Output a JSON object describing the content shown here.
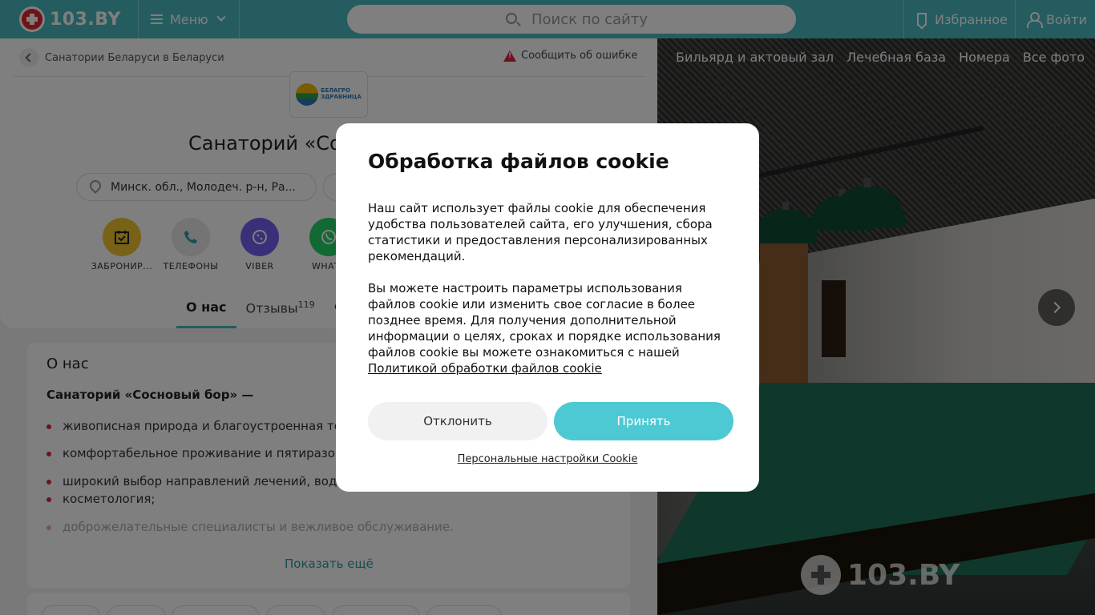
{
  "header": {
    "logo_text": "103.BY",
    "menu_label": "Меню",
    "search_placeholder": "Поиск по сайту",
    "favorites_label": "Избранное",
    "login_label": "Войти"
  },
  "breadcrumb": {
    "text": "Санатории Беларуси в Беларуси",
    "report_label": "Сообщить об ошибке"
  },
  "org": {
    "logo_text_top": "БЕЛАГРО",
    "logo_text_bottom": "ЗДРАВНИЦА",
    "title": "Санаторий «Со",
    "address": "Минск. обл., Молодеч. р-н, Ра..."
  },
  "actions": [
    {
      "label": "ЗАБРОНИР...",
      "icon": "calendar-check-icon",
      "color": "#f0c430"
    },
    {
      "label": "ТЕЛЕФОНЫ",
      "icon": "phone-icon",
      "color": "#e8e8e8"
    },
    {
      "label": "VIBER",
      "icon": "viber-icon",
      "color": "#7360f2"
    },
    {
      "label": "WHATS",
      "icon": "whatsapp-icon",
      "color": "#25d366"
    }
  ],
  "tabs": {
    "about": "О нас",
    "reviews": "Отзывы",
    "reviews_count": "119",
    "third": "Ф"
  },
  "about": {
    "heading": "О нас",
    "lead": "Санаторий «Сосновый бор» —",
    "bullets": [
      "живописная природа и благоустроенная те",
      "комфортабельное проживание и пятиразо",
      "широкий выбор направлений лечений, вод",
      "косметология;",
      "доброжелательные специалисты и вежливое обслуживание."
    ],
    "show_more": "Показать ещё"
  },
  "photo_nav": [
    "Бильярд и актовый зал",
    "Лечебная база",
    "Номера",
    "Все фото"
  ],
  "watermark": "103.BY",
  "cookie_modal": {
    "title": "Обработка файлов cookie",
    "paragraph1": "Наш сайт использует файлы cookie для обеспечения удобства пользователей сайта, его улучшения, сбора статистики и предоставления персонализированных рекомендаций.",
    "paragraph2": "Вы можете настроить параметры использования файлов cookie или изменить свое согласие в более позднее время. Для получения дополнительной информации о целях, сроках и порядке использования файлов cookie вы можете ознакомиться с нашей",
    "policy_link": "Политикой обработки файлов cookie",
    "decline_label": "Отклонить",
    "accept_label": "Принять",
    "settings_label": "Персональные настройки Cookie"
  },
  "colors": {
    "brand": "#4ab8bf",
    "accept": "#4dc9d3",
    "accent_red": "#d7263d"
  }
}
